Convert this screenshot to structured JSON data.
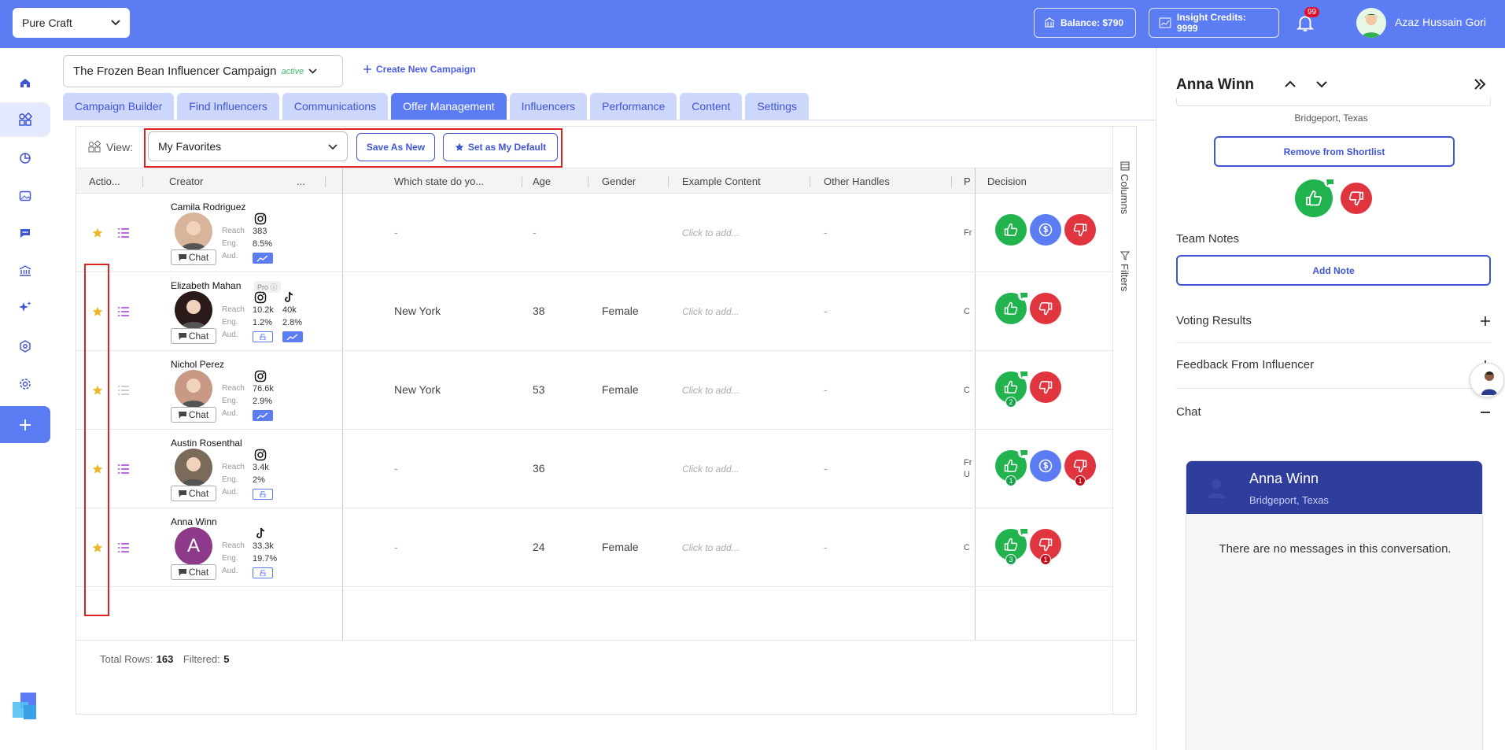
{
  "topbar": {
    "brand": "Pure Craft",
    "balance": "Balance: $790",
    "insight_credits": "Insight Credits: 9999",
    "notifications_count": "99",
    "user_name": "Azaz Hussain Gori"
  },
  "campaign": {
    "name": "The Frozen Bean Influencer Campaign",
    "status": "active",
    "create_new": "Create New Campaign"
  },
  "tabs": [
    "Campaign Builder",
    "Find Influencers",
    "Communications",
    "Offer Management",
    "Influencers",
    "Performance",
    "Content",
    "Settings"
  ],
  "active_tab": "Offer Management",
  "view": {
    "label": "View:",
    "selected": "My Favorites",
    "save_as_new": "Save As New",
    "set_default": "Set as My Default"
  },
  "columns": {
    "actions": "Actio...",
    "creator": "Creator",
    "trunc": "...",
    "state": "Which state do yo...",
    "age": "Age",
    "gender": "Gender",
    "example": "Example Content",
    "handles": "Other Handles",
    "p": "P",
    "decision": "Decision"
  },
  "metric_labels": {
    "reach": "Reach",
    "eng": "Eng.",
    "aud": "Aud."
  },
  "chat_label": "Chat",
  "pro_label": "Pro",
  "placeholder": "Click to add...",
  "rows": [
    {
      "name": "Camila Rodriguez",
      "reach": "383",
      "eng": "8.5%",
      "reach2": "",
      "eng2": "",
      "state": "-",
      "age": "-",
      "gender": "",
      "example": "Click to add...",
      "handles": "-",
      "p": "Fr",
      "decision_likes": "",
      "decision_dislikes": ""
    },
    {
      "name": "Elizabeth Mahan",
      "reach": "10.2k",
      "eng": "1.2%",
      "reach2": "40k",
      "eng2": "2.8%",
      "state": "New York",
      "age": "38",
      "gender": "Female",
      "example": "Click to add...",
      "handles": "-",
      "p": "C",
      "decision_likes": "",
      "decision_dislikes": ""
    },
    {
      "name": "Nichol Perez",
      "reach": "76.6k",
      "eng": "2.9%",
      "reach2": "",
      "eng2": "",
      "state": "New York",
      "age": "53",
      "gender": "Female",
      "example": "Click to add...",
      "handles": "-",
      "p": "C",
      "decision_likes": "2",
      "decision_dislikes": ""
    },
    {
      "name": "Austin Rosenthal",
      "reach": "3.4k",
      "eng": "2%",
      "reach2": "",
      "eng2": "",
      "state": "-",
      "age": "36",
      "gender": "",
      "example": "Click to add...",
      "handles": "-",
      "p": "Fr U",
      "decision_likes": "1",
      "decision_dislikes": "1"
    },
    {
      "name": "Anna Winn",
      "reach": "33.3k",
      "eng": "19.7%",
      "reach2": "",
      "eng2": "",
      "state": "-",
      "age": "24",
      "gender": "Female",
      "example": "Click to add...",
      "handles": "-",
      "p": "C",
      "decision_likes": "3",
      "decision_dislikes": "1",
      "initial": "A"
    }
  ],
  "side_tools": {
    "columns": "Columns",
    "filters": "Filters"
  },
  "footer": {
    "total_label": "Total Rows:",
    "total": "163",
    "filtered_label": "Filtered:",
    "filtered": "5"
  },
  "panel": {
    "name": "Anna Winn",
    "location": "Bridgeport, Texas",
    "remove_shortlist": "Remove from Shortlist",
    "team_notes": "Team Notes",
    "add_note": "Add Note",
    "voting_results": "Voting Results",
    "feedback": "Feedback From Influencer",
    "chat": "Chat",
    "chat_name": "Anna Winn",
    "chat_location": "Bridgeport, Texas",
    "no_messages": "There are no messages in this conversation."
  },
  "colors": {
    "primary": "#5b7cf2",
    "like": "#21b34e",
    "dislike": "#e0343e",
    "chat_header": "#2f3e9c"
  }
}
